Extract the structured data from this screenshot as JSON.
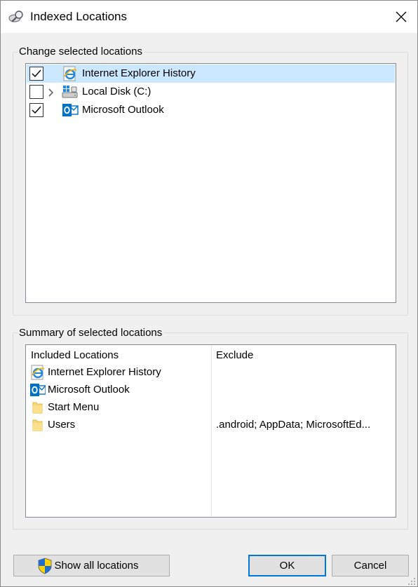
{
  "window": {
    "title": "Indexed Locations"
  },
  "change_group": {
    "label": "Change selected locations",
    "items": [
      {
        "label": "Internet Explorer History",
        "checked": true,
        "selected": true,
        "expandable": false,
        "icon": "internet-explorer-icon"
      },
      {
        "label": "Local Disk (C:)",
        "checked": false,
        "selected": false,
        "expandable": true,
        "icon": "local-disk-icon"
      },
      {
        "label": "Microsoft Outlook",
        "checked": true,
        "selected": false,
        "expandable": false,
        "icon": "outlook-icon"
      }
    ]
  },
  "summary_group": {
    "label": "Summary of selected locations",
    "col_included": "Included Locations",
    "col_exclude": "Exclude",
    "rows": [
      {
        "label": "Internet Explorer History",
        "exclude": "",
        "icon": "internet-explorer-icon"
      },
      {
        "label": "Microsoft Outlook",
        "exclude": "",
        "icon": "outlook-icon"
      },
      {
        "label": "Start Menu",
        "exclude": "",
        "icon": "folder-icon"
      },
      {
        "label": "Users",
        "exclude": ".android; AppData; MicrosoftEd...",
        "icon": "folder-icon"
      }
    ]
  },
  "buttons": {
    "show_all": "Show all locations",
    "ok": "OK",
    "cancel": "Cancel"
  },
  "colors": {
    "selection": "#cce8ff",
    "accent": "#0078d7"
  }
}
